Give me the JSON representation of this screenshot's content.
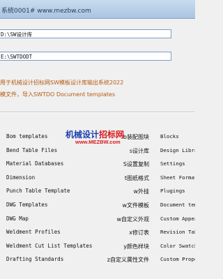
{
  "window": {
    "title": "系统0001# www.mezbw.com"
  },
  "source_path": {
    "value": "D:\\SW设计库"
  },
  "target_path": {
    "value": "E:\\SWTDODT"
  },
  "info": {
    "line1": "用于机械设计招标网SW模板设计库输出系统2022",
    "line2": "模文件，导入SWTDO Document templates"
  },
  "watermark": {
    "brand_blue": "机械设计",
    "brand_red": "招标网",
    "url": "www.MEZBW.com"
  },
  "rows": [
    {
      "name": "Bom templates",
      "cn": "b装配图块",
      "right": "Blocks"
    },
    {
      "name": "Bend Table Files",
      "cn": "s设计库",
      "right": "Design Library"
    },
    {
      "name": "Material Databases",
      "cn": "S设置复制",
      "right": "Settings"
    },
    {
      "name": "Dimension",
      "cn": "t图纸格式",
      "right": "Sheet Formats"
    },
    {
      "name": "Punch Table Template",
      "cn": "w外挂",
      "right": "Plugings"
    },
    {
      "name": "DWG Templates",
      "cn": "w文件模板",
      "right": "Document templates"
    },
    {
      "name": "DWG Map",
      "cn": "w自定义外观",
      "right": "Custom Appearances"
    },
    {
      "name": "Weldment Profiles",
      "cn": "x修订表",
      "right": "Revision Table"
    },
    {
      "name": "Weldment Cut List Templates",
      "cn": "y颜色样块",
      "right": "Color Swatches"
    },
    {
      "name": "Drafting Standards",
      "cn": "z自定义属性文件",
      "right": "Custom Properties"
    }
  ],
  "colors": {
    "titlebar": "#a9c4e2",
    "info_text": "#b55a10",
    "watermark_blue": "#1c3fae",
    "watermark_red": "#d9191f"
  }
}
